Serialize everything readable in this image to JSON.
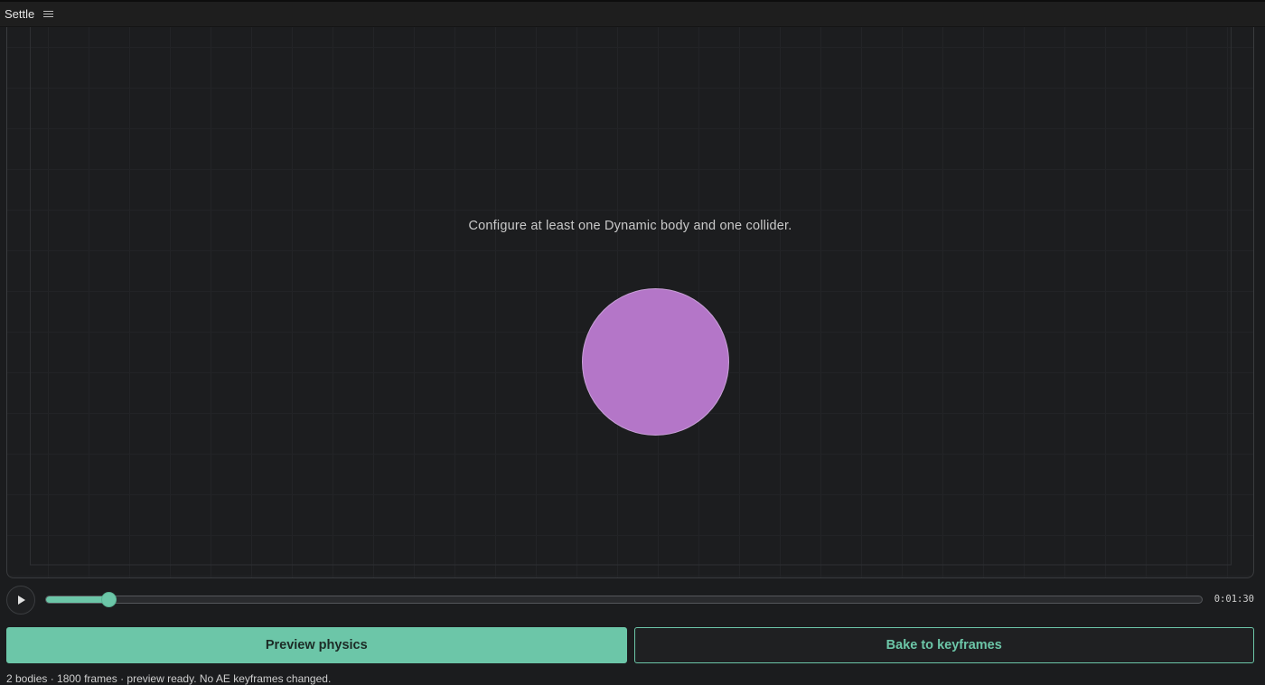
{
  "panel": {
    "title": "Settle",
    "menu_icon": "hamburger-menu-icon"
  },
  "stage": {
    "message": "Configure at least one Dynamic body and one collider.",
    "body_color": "#b476c8"
  },
  "transport": {
    "play_icon": "play-icon",
    "progress": 0.055,
    "timecode": "0:01:30"
  },
  "actions": {
    "preview_label": "Preview physics",
    "bake_label": "Bake to keyframes"
  },
  "status": {
    "text": "2 bodies · 1800 frames · preview ready. No AE keyframes changed."
  },
  "colors": {
    "accent": "#6cc6a8",
    "background": "#1b1c1e",
    "body": "#b476c8"
  }
}
